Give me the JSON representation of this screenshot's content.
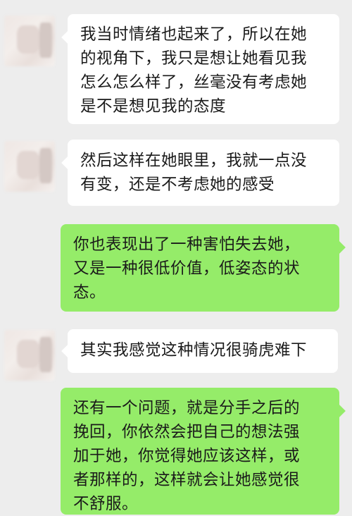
{
  "chat": {
    "messages": [
      {
        "side": "left",
        "lines": [
          "我当时情绪也起来了，所以在她",
          "的视角下，我只是想让她看见我",
          "怎么怎么样了，丝毫没有考虑她",
          "是不是想见我的态度"
        ]
      },
      {
        "side": "left",
        "lines": [
          "然后这样在她眼里，我就一点没",
          "有变，还是不考虑她的感受"
        ]
      },
      {
        "side": "right",
        "lines": [
          "你也表现出了一种害怕失去她，",
          "又是一种很低价值，低姿态的状",
          "态。"
        ]
      },
      {
        "side": "left",
        "lines": [
          "其实我感觉这种情况很骑虎难下"
        ]
      },
      {
        "side": "right",
        "lines": [
          "还有一个问题，就是分手之后的",
          "挽回，你依然会把自己的想法强",
          "加于她，你觉得她应该这样，或",
          "者那样的，这样就会让她感觉很",
          "不舒服。"
        ]
      }
    ]
  }
}
